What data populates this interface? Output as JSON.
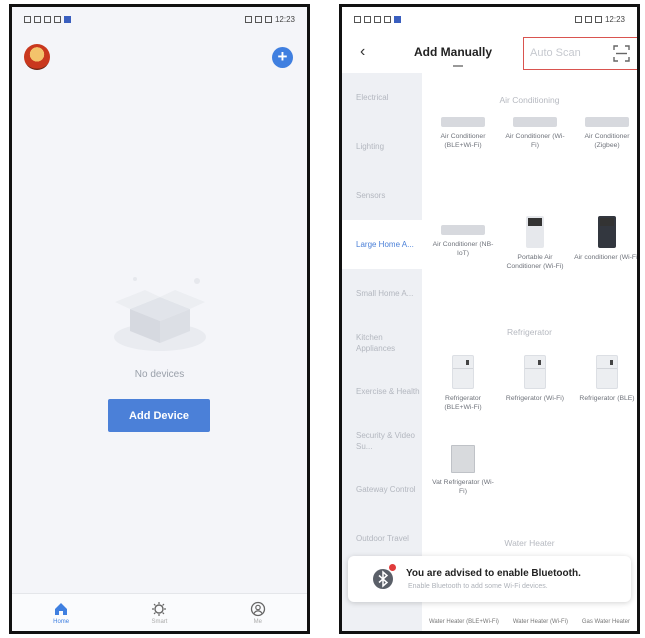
{
  "home": {
    "status_time": "12:23",
    "empty_text": "No devices",
    "add_device_label": "Add Device",
    "tabs": [
      {
        "label": "Home",
        "icon": "home-icon",
        "active": true
      },
      {
        "label": "Smart",
        "icon": "smart-icon",
        "active": false
      },
      {
        "label": "Me",
        "icon": "profile-icon",
        "active": false
      }
    ]
  },
  "add_manually": {
    "status_time": "12:23",
    "title": "Add Manually",
    "auto_scan_label": "Auto Scan",
    "categories": [
      {
        "label": "Electrical",
        "active": false
      },
      {
        "label": "Lighting",
        "active": false
      },
      {
        "label": "Sensors",
        "active": false
      },
      {
        "label": "Large Home A...",
        "active": true
      },
      {
        "label": "Small Home A...",
        "active": false
      },
      {
        "label": "Kitchen Appliances",
        "active": false
      },
      {
        "label": "Exercise & Health",
        "active": false
      },
      {
        "label": "Security & Video Su...",
        "active": false
      },
      {
        "label": "Gateway Control",
        "active": false
      },
      {
        "label": "Outdoor Travel",
        "active": false
      }
    ],
    "sections": [
      {
        "title": "Air Conditioning",
        "devices": [
          {
            "label": "Air Conditioner (BLE+Wi-Fi)",
            "icon": "air-conditioner-icon"
          },
          {
            "label": "Air Conditioner (Wi-Fi)",
            "icon": "air-conditioner-icon"
          },
          {
            "label": "Air Conditioner (Zigbee)",
            "icon": "air-conditioner-icon"
          },
          {
            "label": "Air Conditioner (NB-IoT)",
            "icon": "air-conditioner-icon"
          },
          {
            "label": "Portable Air Conditioner (Wi-Fi)",
            "icon": "portable-ac-icon"
          },
          {
            "label": "Air conditioner (Wi-Fi)",
            "icon": "portable-ac-dark-icon"
          }
        ]
      },
      {
        "title": "Refrigerator",
        "devices": [
          {
            "label": "Refrigerator (BLE+Wi-Fi)",
            "icon": "refrigerator-icon"
          },
          {
            "label": "Refrigerator (Wi-Fi)",
            "icon": "refrigerator-icon"
          },
          {
            "label": "Refrigerator (BLE)",
            "icon": "refrigerator-icon"
          },
          {
            "label": "Vat Refrigerator (Wi-Fi)",
            "icon": "vat-refrigerator-icon"
          }
        ]
      },
      {
        "title": "Water Heater",
        "devices": []
      }
    ],
    "bottom_labels": [
      "Water Heater (BLE+Wi-Fi)",
      "Water Heater (Wi-Fi)",
      "Gas Water Heater"
    ],
    "toast": {
      "title": "You are advised to enable Bluetooth.",
      "subtitle": "Enable Bluetooth to add some Wi-Fi devices."
    }
  }
}
